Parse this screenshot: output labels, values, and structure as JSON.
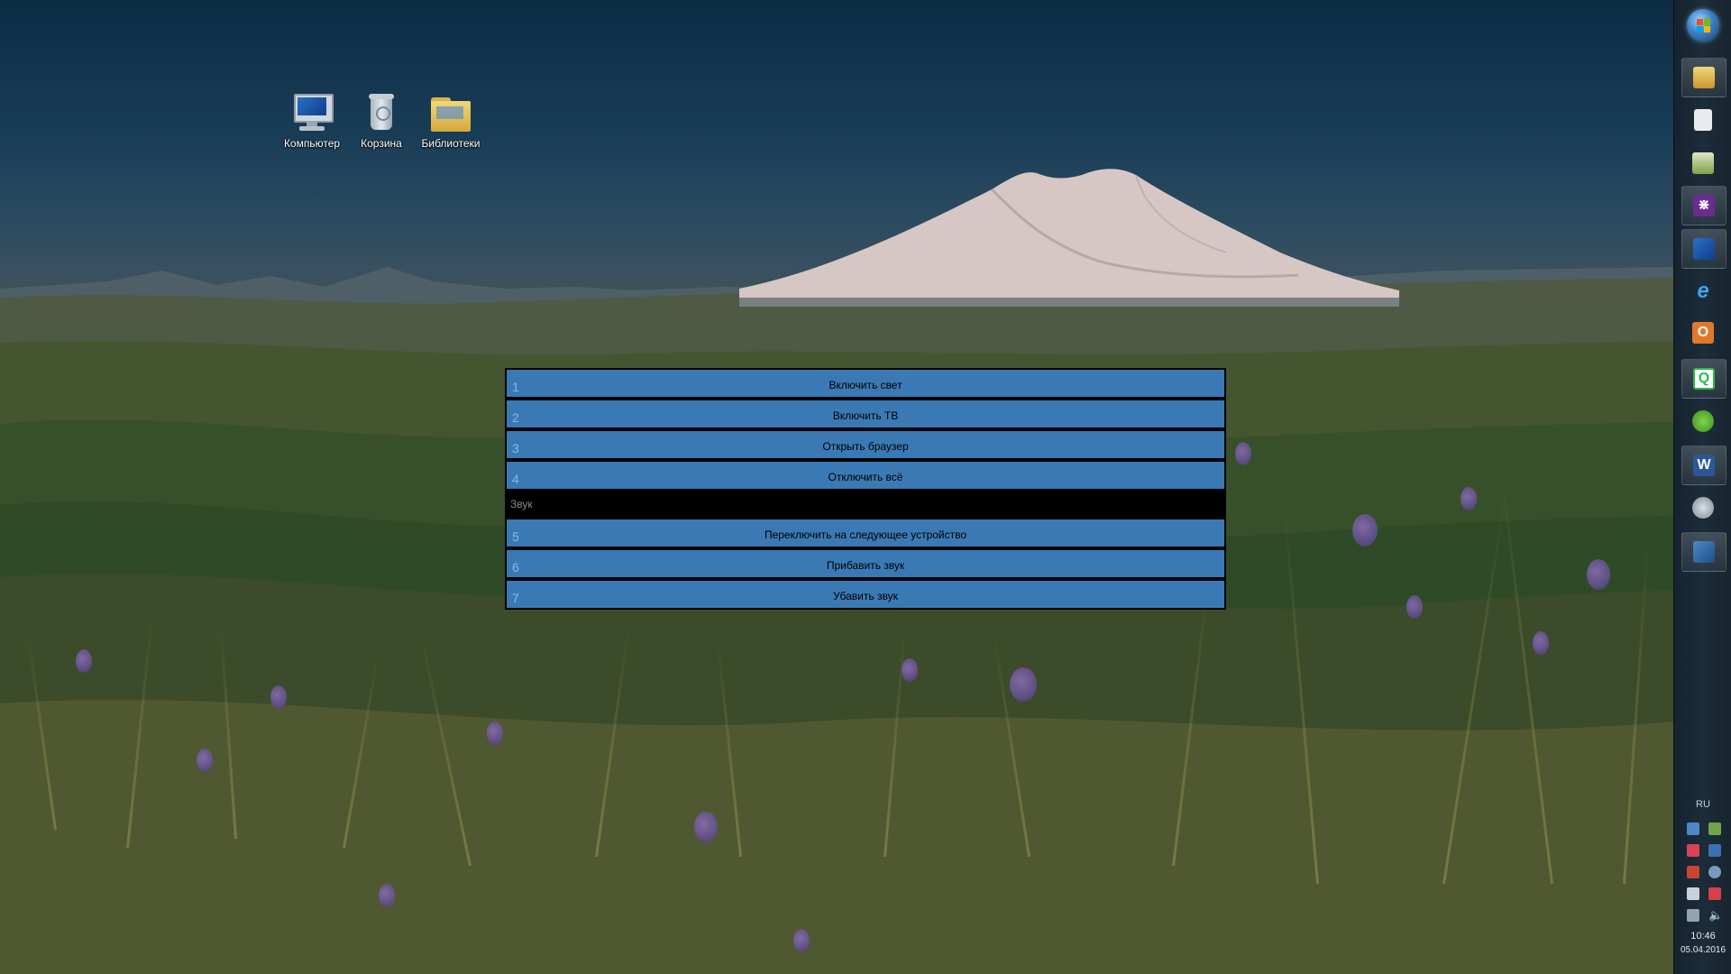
{
  "desktop_icons": [
    {
      "label": "Компьютер",
      "icon": "computer-icon"
    },
    {
      "label": "Корзина",
      "icon": "recycle-bin-icon"
    },
    {
      "label": "Библиотеки",
      "icon": "libraries-folder-icon"
    }
  ],
  "menu": {
    "items": [
      {
        "num": "1",
        "label": "Включить свет"
      },
      {
        "num": "2",
        "label": "Включить ТВ"
      },
      {
        "num": "3",
        "label": "Открыть браузер"
      },
      {
        "num": "4",
        "label": "Отключить всё"
      }
    ],
    "sound_section": {
      "title": "Звук",
      "items": [
        {
          "num": "5",
          "label": "Переключить на следующее устройство"
        },
        {
          "num": "6",
          "label": "Прибавить звук"
        },
        {
          "num": "7",
          "label": "Убавить звук"
        }
      ]
    },
    "colors": {
      "item_bg": "#3b79b4",
      "panel_bg": "#000000"
    }
  },
  "taskbar": {
    "pinned": [
      {
        "icon": "file-explorer-icon"
      },
      {
        "icon": "blank-document-icon"
      },
      {
        "icon": "resource-monitor-icon"
      },
      {
        "icon": "visual-studio-icon"
      },
      {
        "icon": "remote-desktop-icon"
      },
      {
        "icon": "internet-explorer-icon"
      },
      {
        "icon": "outlook-icon"
      },
      {
        "icon": "qip-messenger-icon"
      },
      {
        "icon": "icq-icon"
      },
      {
        "icon": "word-icon"
      },
      {
        "icon": "settings-disc-icon"
      },
      {
        "icon": "network-app-icon"
      }
    ],
    "language": "RU",
    "clock": {
      "time": "10:46",
      "date": "05.04.2016"
    }
  }
}
